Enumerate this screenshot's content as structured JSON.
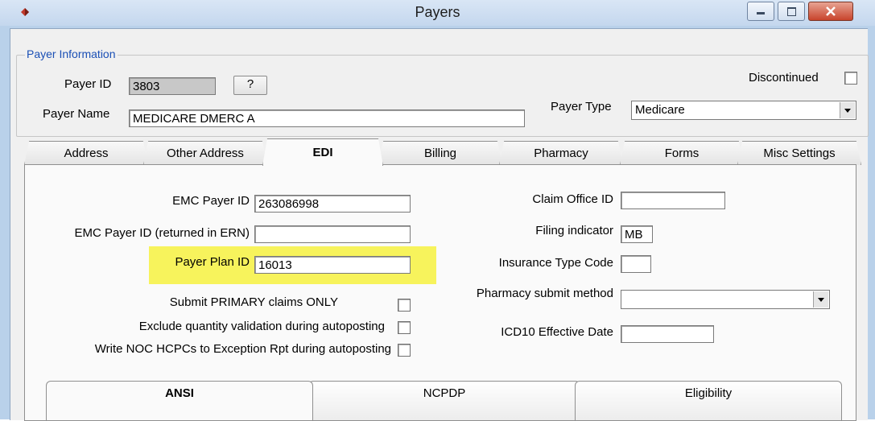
{
  "window": {
    "title": "Payers"
  },
  "payer_info": {
    "group_label": "Payer Information",
    "payer_id_label": "Payer ID",
    "payer_id_value": "3803",
    "lookup_button": "?",
    "payer_name_label": "Payer Name",
    "payer_name_value": "MEDICARE DMERC A",
    "discontinued_label": "Discontinued",
    "discontinued_checked": false,
    "payer_type_label": "Payer Type",
    "payer_type_value": "Medicare"
  },
  "tabs": [
    "Address",
    "Other Address",
    "EDI",
    "Billing",
    "Pharmacy",
    "Forms",
    "Misc Settings"
  ],
  "active_tab": "EDI",
  "edi": {
    "emc_payer_id_label": "EMC Payer ID",
    "emc_payer_id_value": "263086998",
    "emc_payer_id_ern_label": "EMC Payer ID (returned in ERN)",
    "emc_payer_id_ern_value": "",
    "payer_plan_id_label": "Payer Plan ID",
    "payer_plan_id_value": "16013",
    "submit_primary_label": "Submit PRIMARY claims ONLY",
    "exclude_qty_label": "Exclude quantity validation during autoposting",
    "write_noc_label": "Write NOC HCPCs to Exception Rpt during autoposting",
    "claim_office_id_label": "Claim Office ID",
    "claim_office_id_value": "",
    "filing_indicator_label": "Filing indicator",
    "filing_indicator_value": "MB",
    "insurance_type_label": "Insurance Type Code",
    "insurance_type_value": "",
    "pharmacy_submit_label": "Pharmacy submit method",
    "pharmacy_submit_value": "",
    "icd10_label": "ICD10 Effective Date",
    "icd10_value": ""
  },
  "subtabs": [
    "ANSI",
    "NCPDP",
    "Eligibility"
  ],
  "active_subtab": "ANSI",
  "colors": {
    "highlight": "#f7f35c",
    "group_label": "#1a4fb5"
  }
}
